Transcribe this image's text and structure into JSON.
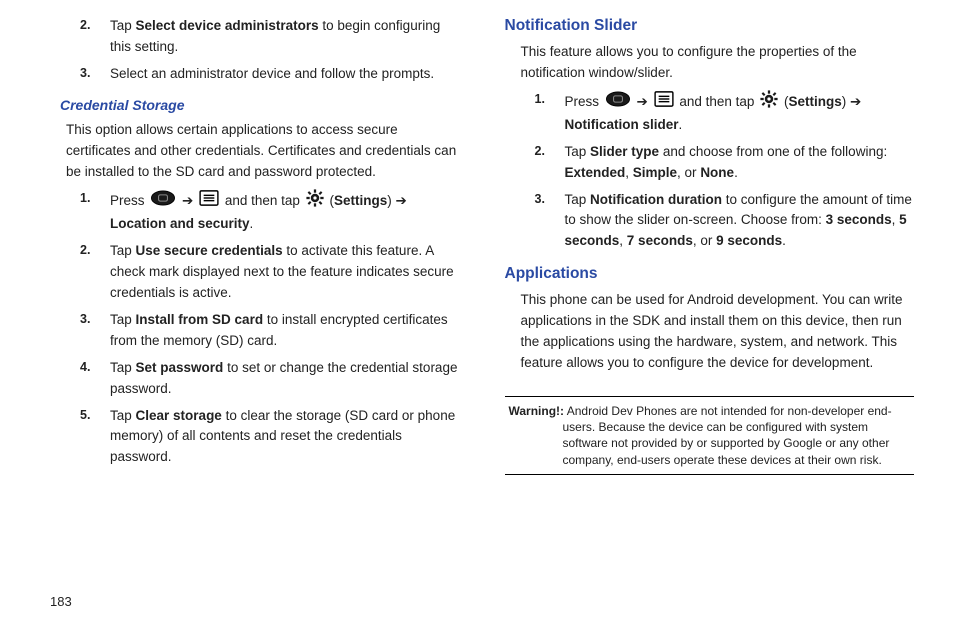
{
  "page_number": "183",
  "left": {
    "items_top": [
      {
        "num": "2.",
        "pre": "Tap ",
        "bold": "Select device administrators",
        "post": " to begin configuring this setting."
      },
      {
        "num": "3.",
        "pre": "",
        "bold": "",
        "post": "Select an administrator device and follow the prompts."
      }
    ],
    "cred_heading": "Credential Storage",
    "cred_intro": "This option allows certain applications to access secure certificates and other credentials. Certificates and credentials can be installed to the SD card and password protected.",
    "cred_items": {
      "1": {
        "num": "1.",
        "press": "Press",
        "then": " and then tap ",
        "open_paren": "(",
        "settings": "Settings",
        "close_arrow": ") ➔ ",
        "target": "Location and security",
        "period": "."
      },
      "2": {
        "num": "2.",
        "pre": "Tap ",
        "bold": "Use secure credentials",
        "post": " to activate this feature. A check mark displayed next to the feature indicates secure credentials is active."
      },
      "3": {
        "num": "3.",
        "pre": "Tap ",
        "bold": "Install from SD card",
        "post": " to install encrypted certificates from the memory (SD) card."
      },
      "4": {
        "num": "4.",
        "pre": "Tap ",
        "bold": "Set password",
        "post": " to set or change the credential storage password."
      },
      "5": {
        "num": "5.",
        "pre": "Tap ",
        "bold": "Clear storage",
        "post": " to clear the storage (SD card or phone memory) of all contents and reset the credentials password."
      }
    }
  },
  "right": {
    "notif_heading": "Notification Slider",
    "notif_intro": "This feature allows you to configure the properties of the notification window/slider.",
    "notif_items": {
      "1": {
        "num": "1.",
        "press": "Press",
        "then": " and then tap ",
        "open_paren": "(",
        "settings": "Settings",
        "close_arrow": ") ➔ ",
        "target": "Notification slider",
        "period": "."
      },
      "2": {
        "num": "2.",
        "pre": "Tap ",
        "bold": "Slider type",
        "mid": " and choose from one of the following: ",
        "opt1": "Extended",
        "sep1": ", ",
        "opt2": "Simple",
        "sep2": ", or ",
        "opt3": "None",
        "end": "."
      },
      "3": {
        "num": "3.",
        "pre": "Tap ",
        "bold": "Notification duration",
        "mid": " to configure the amount of time to show the slider on-screen. Choose from: ",
        "o1": "3 seconds",
        "s1": ", ",
        "o2": "5 seconds",
        "s2": ", ",
        "o3": "7 seconds",
        "s3": ", or ",
        "o4": "9 seconds",
        "end": "."
      }
    },
    "apps_heading": "Applications",
    "apps_intro": "This phone can be used for Android development. You can write applications in the SDK and install them on this device, then run the applications using the hardware, system, and network. This feature allows you to configure the device for development.",
    "warning_label": "Warning!:",
    "warning_text": " Android Dev Phones are not intended for non-developer end-users. Because the device can be configured with system software not provided by or supported by Google or any other company, end-users operate these devices at their own risk."
  },
  "icons": {
    "arrow": " ➔ "
  }
}
